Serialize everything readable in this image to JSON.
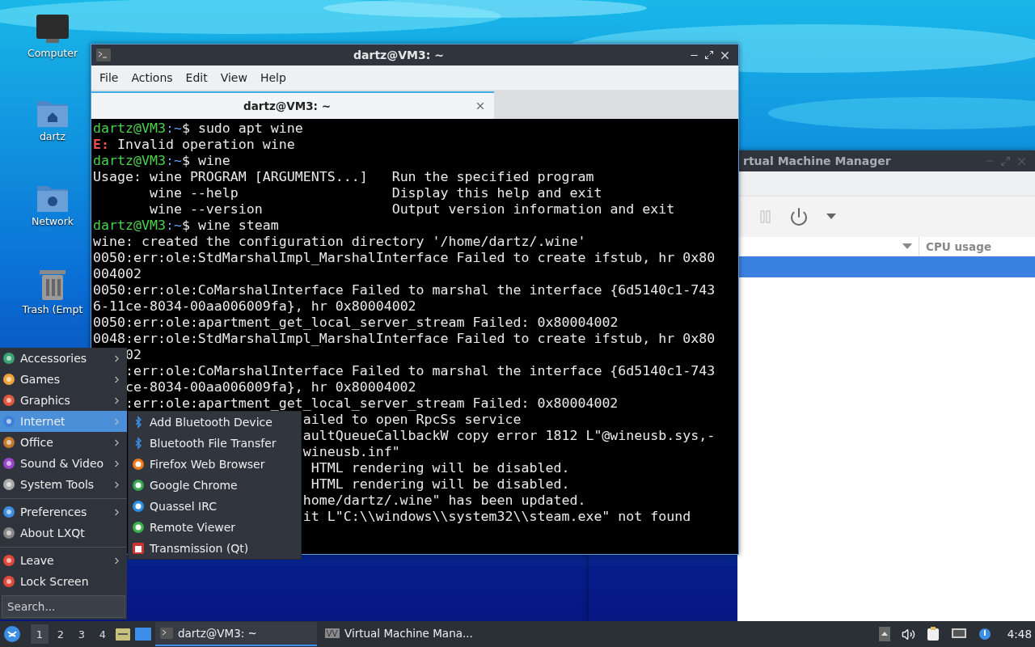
{
  "desktop_icons": [
    {
      "label": "Computer"
    },
    {
      "label": "dartz"
    },
    {
      "label": "Network"
    },
    {
      "label": "Trash (Empt"
    }
  ],
  "vm_window": {
    "title": "rtual Machine Manager",
    "columns": [
      "CPU usage"
    ],
    "rows": [
      {
        "selected": true
      }
    ]
  },
  "terminal_window": {
    "title": "dartz@VM3: ~",
    "menu": [
      "File",
      "Actions",
      "Edit",
      "View",
      "Help"
    ],
    "tabs": [
      {
        "label": "dartz@VM3: ~",
        "selected": true
      }
    ],
    "lines": [
      {
        "kind": "prompt",
        "user": "dartz@VM3",
        "path": ":~",
        "text": "$ sudo apt wine"
      },
      {
        "kind": "error",
        "tag": "E:",
        "text": " Invalid operation wine"
      },
      {
        "kind": "prompt",
        "user": "dartz@VM3",
        "path": ":~",
        "text": "$ wine"
      },
      {
        "kind": "output",
        "text": "Usage: wine PROGRAM [ARGUMENTS...]   Run the specified program"
      },
      {
        "kind": "output",
        "text": "       wine --help                   Display this help and exit"
      },
      {
        "kind": "output",
        "text": "       wine --version                Output version information and exit"
      },
      {
        "kind": "prompt",
        "user": "dartz@VM3",
        "path": ":~",
        "text": "$ wine steam"
      },
      {
        "kind": "output",
        "text": "wine: created the configuration directory '/home/dartz/.wine'"
      },
      {
        "kind": "output",
        "text": "0050:err:ole:StdMarshalImpl_MarshalInterface Failed to create ifstub, hr 0x80"
      },
      {
        "kind": "output",
        "text": "004002"
      },
      {
        "kind": "output",
        "text": "0050:err:ole:CoMarshalInterface Failed to marshal the interface {6d5140c1-743"
      },
      {
        "kind": "output",
        "text": "6-11ce-8034-00aa006009fa}, hr 0x80004002"
      },
      {
        "kind": "output",
        "text": "0050:err:ole:apartment_get_local_server_stream Failed: 0x80004002"
      },
      {
        "kind": "output",
        "text": "0048:err:ole:StdMarshalImpl_MarshalInterface Failed to create ifstub, hr 0x80"
      },
      {
        "kind": "behind_menu",
        "text": "02"
      },
      {
        "kind": "behind_menu",
        "text": ":err:ole:CoMarshalInterface Failed to marshal the interface {6d5140c1-743"
      },
      {
        "kind": "behind_menu",
        "text": "ce-8034-00aa006009fa}, hr 0x80004002"
      },
      {
        "kind": "behind_menu",
        "text": ":err:ole:apartment_get_local_server_stream Failed: 0x80004002"
      },
      {
        "kind": "behind_submenu",
        "text": "ailed to open RpcSs service"
      },
      {
        "kind": "behind_submenu",
        "text": "aultQueueCallbackW copy error 1812 L\"@wineusb.sys,-"
      },
      {
        "kind": "behind_submenu",
        "text": "wineusb.inf\""
      },
      {
        "kind": "behind_submenu",
        "text": " HTML rendering will be disabled."
      },
      {
        "kind": "behind_submenu",
        "text": " HTML rendering will be disabled."
      },
      {
        "kind": "behind_submenu",
        "text": "home/dartz/.wine\" has been updated."
      },
      {
        "kind": "behind_submenu",
        "text": "it L\"C:\\\\windows\\\\system32\\\\steam.exe\" not found"
      }
    ]
  },
  "start_menu": {
    "items": [
      {
        "kind": "item",
        "label": "Accessories",
        "has_submenu": true,
        "selected": false
      },
      {
        "kind": "item",
        "label": "Games",
        "has_submenu": true,
        "selected": false
      },
      {
        "kind": "item",
        "label": "Graphics",
        "has_submenu": true,
        "selected": false
      },
      {
        "kind": "item",
        "label": "Internet",
        "has_submenu": true,
        "selected": true
      },
      {
        "kind": "item",
        "label": "Office",
        "has_submenu": true,
        "selected": false
      },
      {
        "kind": "item",
        "label": "Sound & Video",
        "has_submenu": true,
        "selected": false
      },
      {
        "kind": "item",
        "label": "System Tools",
        "has_submenu": true,
        "selected": false
      },
      {
        "kind": "separator"
      },
      {
        "kind": "item",
        "label": "Preferences",
        "has_submenu": true,
        "selected": false
      },
      {
        "kind": "item",
        "label": "About LXQt",
        "has_submenu": false,
        "selected": false
      },
      {
        "kind": "separator"
      },
      {
        "kind": "item",
        "label": "Leave",
        "has_submenu": true,
        "selected": false
      },
      {
        "kind": "item",
        "label": "Lock Screen",
        "has_submenu": false,
        "selected": false
      }
    ],
    "search": {
      "placeholder": "Search..."
    },
    "submenu": [
      {
        "label": "Add Bluetooth Device"
      },
      {
        "label": "Bluetooth File Transfer"
      },
      {
        "label": "Firefox Web Browser"
      },
      {
        "label": "Google Chrome"
      },
      {
        "label": "Quassel IRC"
      },
      {
        "label": "Remote Viewer"
      },
      {
        "label": "Transmission (Qt)"
      }
    ]
  },
  "taskbar": {
    "workspaces": [
      {
        "label": "1",
        "selected": true
      },
      {
        "label": "2",
        "selected": false
      },
      {
        "label": "3",
        "selected": false
      },
      {
        "label": "4",
        "selected": false
      }
    ],
    "tasks": [
      {
        "label": "dartz@VM3: ~",
        "selected": true
      },
      {
        "label": "Virtual Machine Mana...",
        "selected": false
      }
    ],
    "clock": "4:48"
  }
}
